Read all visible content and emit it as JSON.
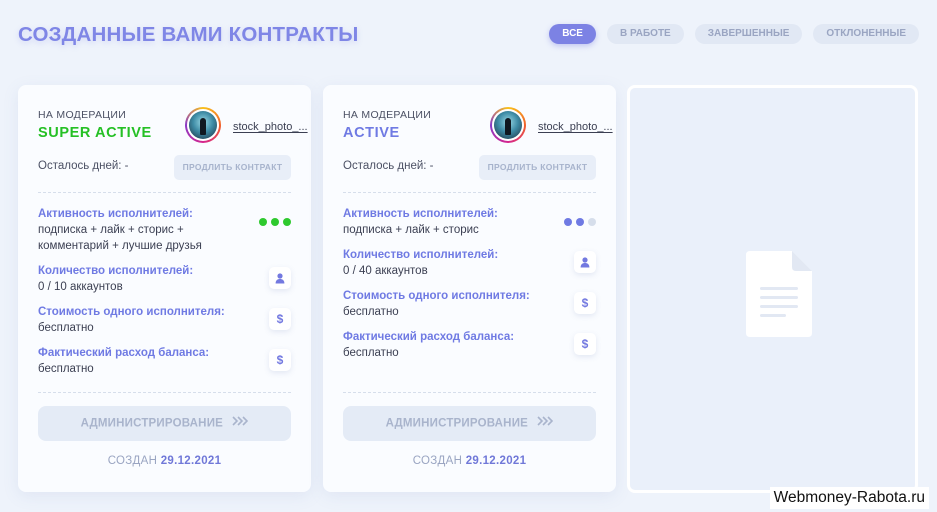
{
  "page": {
    "title": "СОЗДАННЫЕ ВАМИ КОНТРАКТЫ",
    "filters": [
      {
        "label": "ВСЕ",
        "active": true
      },
      {
        "label": "В РАБОТЕ",
        "active": false
      },
      {
        "label": "ЗАВЕРШЕННЫЕ",
        "active": false
      },
      {
        "label": "ОТКЛОНЕННЫЕ",
        "active": false
      }
    ]
  },
  "cards": [
    {
      "status": "НА МОДЕРАЦИИ",
      "tariff": "SUPER ACTIVE",
      "tariff_color": "#25c025",
      "username": "stock_photo_...",
      "days_left": "Осталось дней: -",
      "extend_label": "ПРОДЛИТЬ КОНТРАКТ",
      "activity_title": "Активность исполнителей:",
      "activity_value": "подписка + лайк + сторис + комментарий + лучшие друзья",
      "activity_level": 3,
      "activity_dot_on": "#2ec92e",
      "activity_dot_off": "#d6deeb",
      "count_title": "Количество исполнителей:",
      "count_value": "0 / 10 аккаунтов",
      "cost_title": "Стоимость одного исполнителя:",
      "cost_value": "бесплатно",
      "spend_title": "Фактический расход баланса:",
      "spend_value": "бесплатно",
      "admin_label": "АДМИНИСТРИРОВАНИЕ",
      "created_label": "СОЗДАН",
      "created_date": "29.12.2021",
      "icons": {
        "count": "user-icon",
        "cost": "dollar-icon",
        "spend": "dollar-icon",
        "admin": "double-chevron-right-icon"
      }
    },
    {
      "status": "НА МОДЕРАЦИИ",
      "tariff": "ACTIVE",
      "tariff_color": "#6f7ae3",
      "username": "stock_photo_...",
      "days_left": "Осталось дней: -",
      "extend_label": "ПРОДЛИТЬ КОНТРАКТ",
      "activity_title": "Активность исполнителей:",
      "activity_value": "подписка + лайк + сторис",
      "activity_level": 2,
      "activity_dot_on": "#6f7ae3",
      "activity_dot_off": "#d6deeb",
      "count_title": "Количество исполнителей:",
      "count_value": "0 / 40 аккаунтов",
      "cost_title": "Стоимость одного исполнителя:",
      "cost_value": "бесплатно",
      "spend_title": "Фактический расход баланса:",
      "spend_value": "бесплатно",
      "admin_label": "АДМИНИСТРИРОВАНИЕ",
      "created_label": "СОЗДАН",
      "created_date": "29.12.2021",
      "icons": {
        "count": "user-icon",
        "cost": "dollar-icon",
        "spend": "dollar-icon",
        "admin": "double-chevron-right-icon"
      }
    }
  ],
  "empty_slot": {
    "icon": "document-icon"
  },
  "watermark": "Webmoney-Rabota.ru",
  "colors": {
    "accent": "#7c82e4",
    "background": "#eef3fb",
    "card": "#fafcff"
  }
}
